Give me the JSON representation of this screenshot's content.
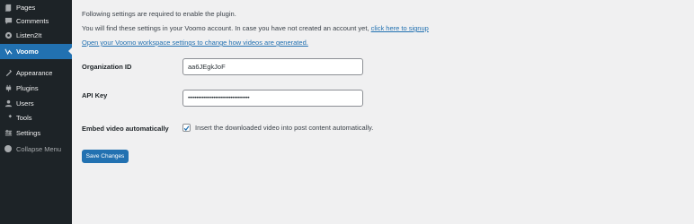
{
  "sidebar": {
    "items": [
      {
        "label": "Pages",
        "icon": "pages-icon"
      },
      {
        "label": "Comments",
        "icon": "comments-icon"
      },
      {
        "label": "Listen2It",
        "icon": "listen2it-icon"
      },
      {
        "label": "Voomo",
        "icon": "voomo-icon"
      },
      {
        "label": "Appearance",
        "icon": "appearance-icon"
      },
      {
        "label": "Plugins",
        "icon": "plugins-icon"
      },
      {
        "label": "Users",
        "icon": "users-icon"
      },
      {
        "label": "Tools",
        "icon": "tools-icon"
      },
      {
        "label": "Settings",
        "icon": "settings-icon"
      },
      {
        "label": "Collapse Menu",
        "icon": "collapse-icon"
      }
    ],
    "active": "Voomo"
  },
  "main": {
    "intro": "Following settings are required to enable the plugin.",
    "info_text": "You will find these settings in your Voomo account. In case you have not created an account yet,",
    "signup_link": "click here to signup",
    "workspace_link": "Open your Voomo workspace settings to change how videos are generated.",
    "org_label": "Organization ID",
    "org_value": "aa6JEgkJoF",
    "api_label": "API Key",
    "api_value": "••••••••••••••••••••••••••••••••••••",
    "embed_label": "Embed video automatically",
    "embed_checkbox_label": "Insert the downloaded video into post content automatically.",
    "embed_checked": true,
    "save_label": "Save Changes"
  },
  "colors": {
    "sidebar_bg": "#1d2327",
    "accent": "#2271b1",
    "page_bg": "#f0f0f1"
  }
}
